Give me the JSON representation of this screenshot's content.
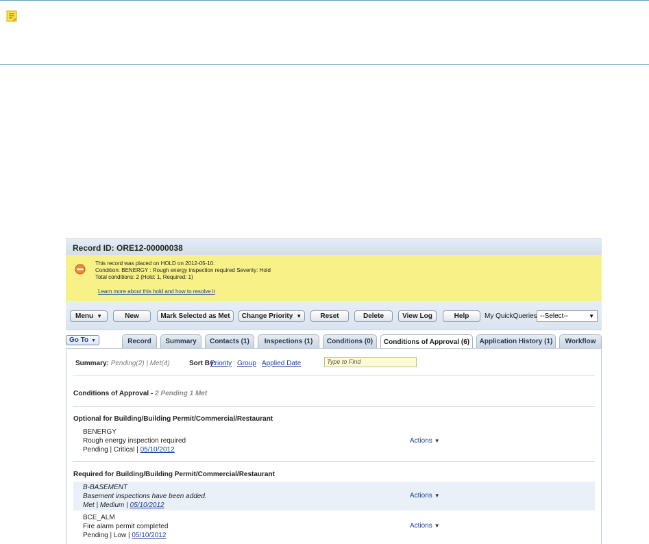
{
  "note_bar": {
    "icon": "note-icon"
  },
  "record": {
    "title": "Record ID: ORE12-00000038"
  },
  "hold": {
    "line1": "This record was placed on HOLD on 2012-05-10.",
    "line2": "Condition: BENERGY : Rough energy inspection required Severity: Hold",
    "line3": "Total conditions: 2   (Hold: 1, Required: 1)",
    "link": "Learn more about this hold and how to resolve it",
    "icon_color": "#e8772a"
  },
  "toolbar": {
    "menu": "Menu",
    "new": "New",
    "mark_met": "Mark Selected as Met",
    "change_priority": "Change Priority",
    "reset": "Reset",
    "delete": "Delete",
    "view_log": "View Log",
    "help": "Help",
    "quick_label": "My QuickQueries",
    "quick_value": "--Select--"
  },
  "goto": "Go To",
  "tabs": [
    {
      "label": "Record"
    },
    {
      "label": "Summary"
    },
    {
      "label": "Contacts (1)"
    },
    {
      "label": "Inspections (1)"
    },
    {
      "label": "Conditions (0)"
    },
    {
      "label": "Conditions of Approval (6)",
      "active": true
    },
    {
      "label": "Application History (1)"
    },
    {
      "label": "Workflow"
    }
  ],
  "summary": {
    "label": "Summary:",
    "pending": "Pending(2)",
    "separator": " | ",
    "met": "Met(4)",
    "sort_label": "Sort By:",
    "sort_priority": "Priority",
    "sort_group": "Group",
    "sort_date": "Applied Date",
    "find_placeholder": "Type to Find"
  },
  "coa_heading": {
    "title": "Conditions of Approval - ",
    "counts": " 2 Pending  1 Met"
  },
  "groups": [
    {
      "heading": "Optional for Building/Building Permit/Commercial/Restaurant",
      "items": [
        {
          "code": "BENERGY",
          "desc": "Rough energy inspection required",
          "status": "Pending | Critical | ",
          "date": "05/10/2012",
          "actions": "Actions"
        }
      ]
    },
    {
      "heading": "Required for Building/Building Permit/Commercial/Restaurant",
      "items": [
        {
          "code": "B-BASEMENT",
          "desc": "Basement inspections have been added.",
          "status": "Met | Medium | ",
          "date": "05/10/2012",
          "actions": "Actions"
        },
        {
          "code": "BCE_ALM",
          "desc": "Fire alarm permit completed",
          "status": "Pending | Low | ",
          "date": "05/10/2012",
          "actions": "Actions"
        }
      ]
    }
  ]
}
